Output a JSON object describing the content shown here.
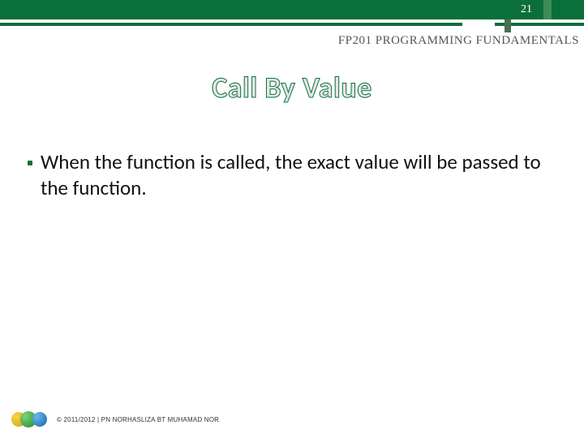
{
  "page_number": "21",
  "course_code": "FP201 PROGRAMMING FUNDAMENTALS",
  "slide_title": "Call By Value",
  "bullets": [
    "When the function is called, the exact value will be passed to the function."
  ],
  "footer": {
    "copyright": "© 2011/2012 | PN NORHASLIZA BT MUHAMAD NOR"
  },
  "colors": {
    "brand_green": "#0b6f3a",
    "title_stroke": "#09713c"
  }
}
